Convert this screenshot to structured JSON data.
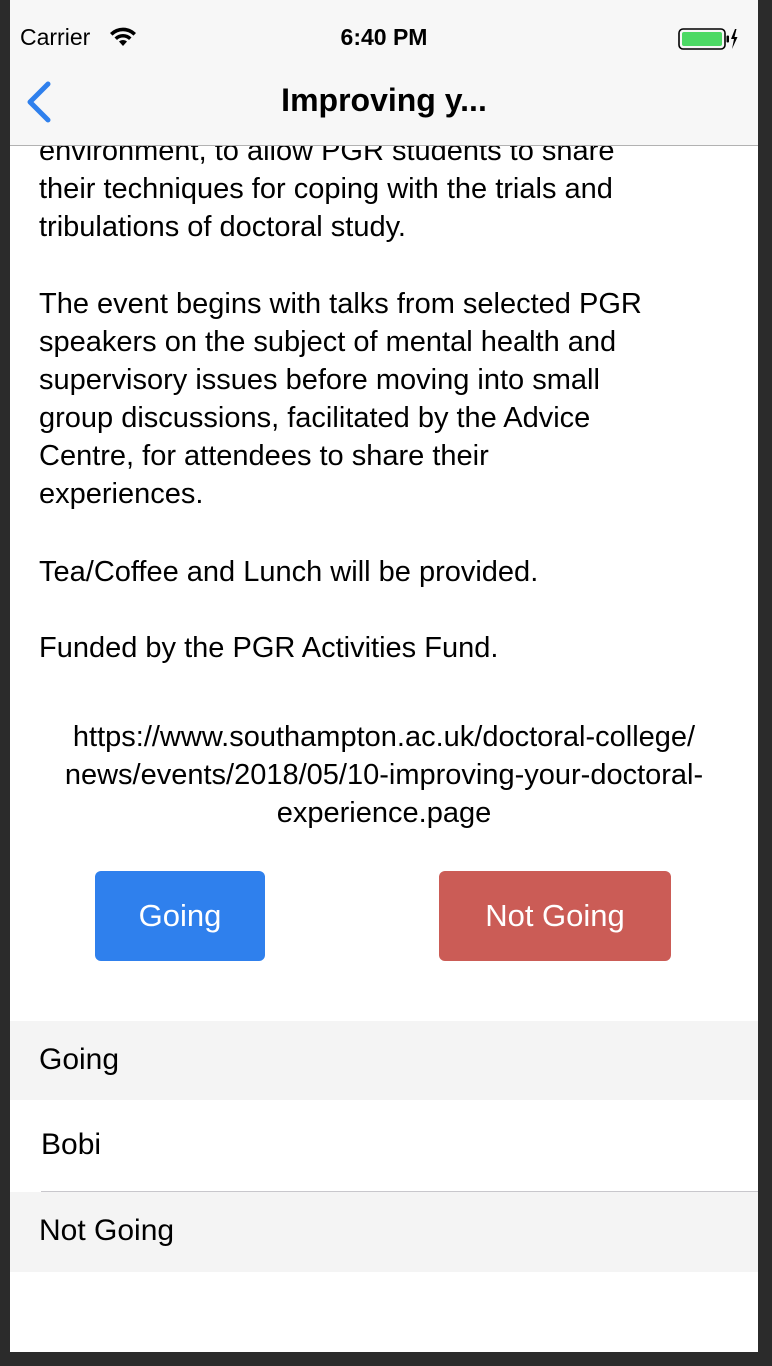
{
  "status_bar": {
    "carrier": "Carrier",
    "time": "6:40 PM",
    "wifi_icon": "wifi-icon",
    "battery_icon": "battery-charging-icon",
    "battery_color": "#4cd964"
  },
  "nav_bar": {
    "title": "Improving y...",
    "back_icon": "chevron-left-icon",
    "accent": "#2f80ed"
  },
  "content": {
    "paragraph_1_lines": [
      "environment, to allow PGR students to share",
      "their techniques for coping with the trials and",
      "tribulations of doctoral study."
    ],
    "paragraph_2_lines": [
      "The event begins with talks from selected PGR",
      "speakers on the subject of mental health and",
      "supervisory issues before moving into small",
      "group discussions, facilitated by the Advice",
      "Centre, for attendees to share their",
      "experiences."
    ],
    "paragraph_3": "Tea/Coffee and Lunch will be provided.",
    "paragraph_4": "Funded by the PGR Activities Fund.",
    "url_lines": [
      "https://www.southampton.ac.uk/doctoral-college/",
      "news/events/2018/05/10-improving-your-doctoral-",
      "experience.page"
    ]
  },
  "actions": {
    "going_label": "Going",
    "not_going_label": "Not Going",
    "going_color": "#2f80ed",
    "not_going_color": "#cb5c56"
  },
  "attendees": {
    "going_header": "Going",
    "going_list": [
      "Bobi"
    ],
    "not_going_header": "Not Going",
    "not_going_list": []
  }
}
